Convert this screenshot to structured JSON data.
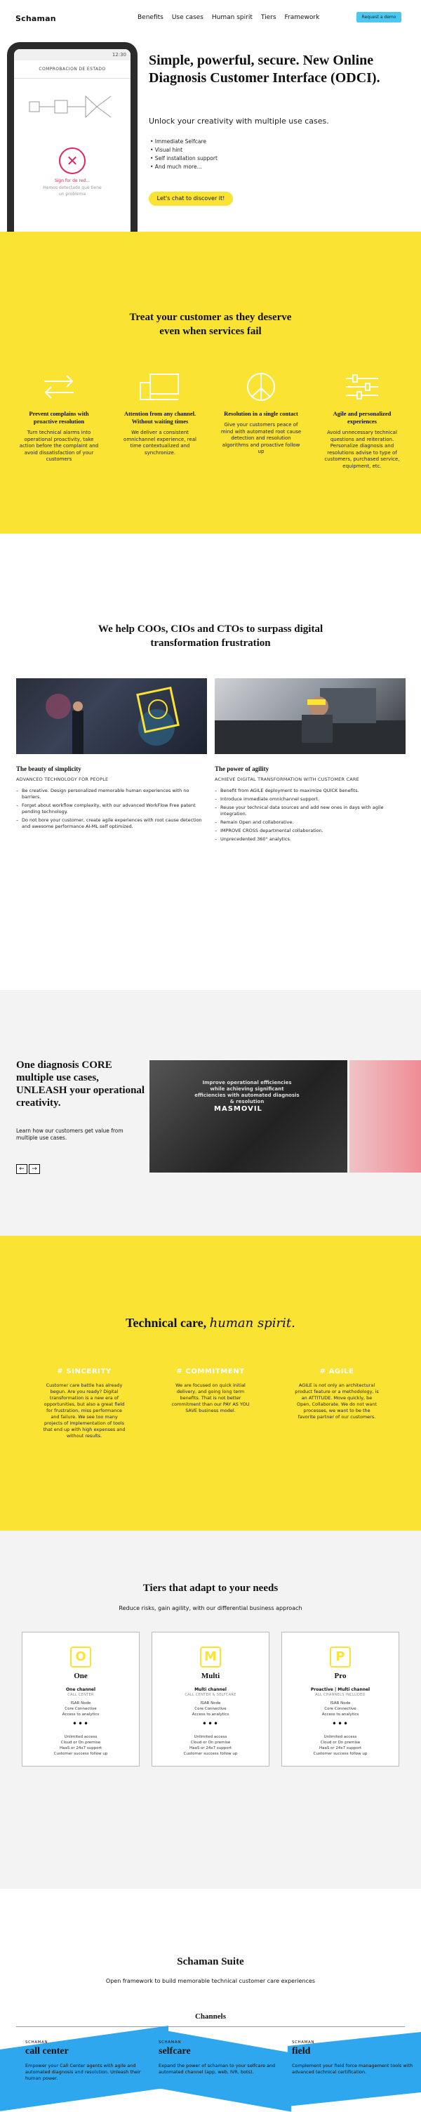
{
  "nav": {
    "logo": "Schaman",
    "items": [
      "Benefits",
      "Use cases",
      "Human spirit",
      "Tiers",
      "Framework"
    ],
    "cta": "Request a demo"
  },
  "hero": {
    "phone": {
      "time": "12:30",
      "title": "COMPROBACION DE ESTADO",
      "error_icon": "close-icon",
      "error_title": "Sign for de red...",
      "error_sub": "Hemos detectado que tiene\nun problema"
    },
    "title": "Simple, powerful, secure. New Online Diagnosis Customer Interface (ODCI).",
    "subtitle": "Unlock your creativity with multiple use cases.",
    "bullets": [
      "• Immediate Selfcare",
      "• Visual hint",
      "• Self installation support",
      "• And much more..."
    ],
    "button": "Let's chat to discover it!"
  },
  "benefits": {
    "title": "Treat your customer as they deserve even when services fail",
    "items": [
      {
        "icon": "arrows-icon",
        "title": "Prevent complains with proactive resolution",
        "text": "Turn technical alarms into operational proactivity, take action before the complaint and avoid dissatisfaction of your customers"
      },
      {
        "icon": "devices-icon",
        "title": "Attention from any channel. Without waiting times",
        "text": "We deliver a consistent omnichannel experience, real time contextualized and synchronize."
      },
      {
        "icon": "peace-icon",
        "title": "Resolution in a single contact",
        "text": "Give your customers peace of mind with automated root cause detection and resolution algorithms and proactive follow up"
      },
      {
        "icon": "sliders-icon",
        "title": "Agile and personalized experiences",
        "text": "Avoid unnecessary technical questions and reiteration. Personalize diagnosis and resolutions advise to type of customers, purchased service, equipment, etc."
      }
    ]
  },
  "usecases": {
    "title": "We help COOs, CIOs and CTOs to surpass digital transformation frustration",
    "left": {
      "title": "The beauty of simplicity",
      "tag": "ADVANCED TECHNOLOGY FOR PEOPLE",
      "items": [
        "Be creative. Design personalized memorable human experiences with no barriers.",
        "Forget about workflow complexity, with our advanced WorkFlow Free patent pending technology.",
        "Do not bore your customer, create agile experiences with root cause detection and awesome performance AI-ML self optimized."
      ]
    },
    "right": {
      "title": "The power of agility",
      "tag": "ACHIEVE DIGITAL TRANSFORMATION WITH CUSTOMER CARE",
      "items": [
        "Benefit from AGILE deployment to maximize QUICK benefits.",
        "Introduce immediate omnichannel support.",
        "Reuse your technical data sources and add new ones in days with agile integration.",
        "Remain Open and collaborative.",
        "IMPROVE CROSS departmental collaboration.",
        "Unprecedented 360° analytics."
      ]
    }
  },
  "core": {
    "title": "One diagnosis CORE multiple use cases, UNLEASH your operational creativity.",
    "text": "Learn how our customers get value from multiple use cases.",
    "prev": "←",
    "next": "→",
    "card_quote": "Improve operational efficiencies while achieving significant efficiencies with automated diagnosis & resolution",
    "card_brand": "MASMOVIL"
  },
  "spirit": {
    "title": "Technical care,",
    "title_script": "human spirit.",
    "values": [
      {
        "name": "# SINCERITY",
        "text": "Customer care battle has already begun. Are you ready? Digital transformation is a new era of opportunities, but also a great field for frustration, miss performance and failure. We see too many projects of implementation of tools that end up with high expenses and without results."
      },
      {
        "name": "# COMMITMENT",
        "text": "We are focused on quick initial delivery, and going long term benefits. That is not better commitment than our PAY AS YOU SAVE business model."
      },
      {
        "name": "# AGILE",
        "text": "AGILE is not only an architectural product feature or a methodology, is an ATTITUDE. Move quickly, be Open, Collaborate. We do not want processes, we want to be the favorite partner of our customers."
      }
    ]
  },
  "tiers": {
    "title": "Tiers that adapt to your needs",
    "subtitle": "Reduce risks, gain agility, with our differential business approach",
    "plans": [
      {
        "mono": "O",
        "name": "One",
        "l1": "One channel",
        "l2": "CALL CENTER",
        "feats": [
          "ISAR Node",
          "Core Connective",
          "Access to analytics"
        ],
        "dots": "•••",
        "inc": [
          "Unlimited access",
          "Cloud or On premise",
          "HaaS or 24x7 support",
          "Customer success follow up"
        ]
      },
      {
        "mono": "M",
        "name": "Multi",
        "l1": "Multi channel",
        "l2": "CALL CENTER & SELFCARE",
        "feats": [
          "ISAR Node",
          "Core Connective",
          "Access to analytics"
        ],
        "dots": "•••",
        "inc": [
          "Unlimited access",
          "Cloud or On premise",
          "HaaS or 24x7 support",
          "Customer success follow up"
        ]
      },
      {
        "mono": "P",
        "name": "Pro",
        "l1": "Proactive | Multi channel",
        "l2": "ALL CHANNELS INCLUDED",
        "feats": [
          "ISAR Node",
          "Core Connective",
          "Access to analytics"
        ],
        "dots": "•••",
        "inc": [
          "Unlimited access",
          "Cloud or On premise",
          "HaaS or 24x7 support",
          "Customer success follow up"
        ]
      }
    ]
  },
  "suite": {
    "title": "Schaman Suite",
    "subtitle": "Open framework to build memorable technical customer care experiences",
    "channels_title": "Channels",
    "channels": [
      {
        "k": "SCHAMAN",
        "name": "call center",
        "text": "Empower your Call Center agents with agile and automated diagnosis and resolution. Unleash their human power."
      },
      {
        "k": "SCHAMAN",
        "name": "selfcare",
        "text": "Expand the power of schaman to your selfcare and automated channel (app, web, IVR, bots)."
      },
      {
        "k": "SCHAMAN",
        "name": "field",
        "text": "Complement your field force management tools with advanced technical certification."
      }
    ]
  },
  "colors": {
    "yellow": "#fbe334",
    "blue": "#2ea7ee",
    "cta": "#4cc7f0",
    "error": "#e0245e"
  }
}
